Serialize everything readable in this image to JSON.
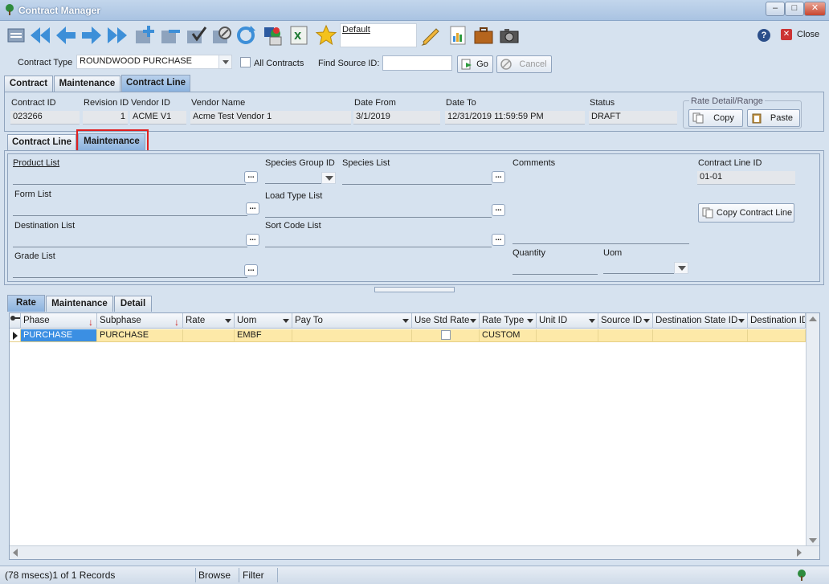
{
  "window": {
    "title": "Contract Manager"
  },
  "toolbar": {
    "default_label": "Default",
    "close_label": "Close"
  },
  "filter": {
    "contract_type_label": "Contract Type",
    "contract_type_value": "ROUNDWOOD PURCHASE",
    "all_contracts_label": "All Contracts",
    "find_source_label": "Find Source ID:",
    "find_source_value": "",
    "go_label": "Go",
    "cancel_label": "Cancel"
  },
  "main_tabs": [
    "Contract",
    "Maintenance",
    "Contract Line"
  ],
  "header": {
    "contract_id_label": "Contract ID",
    "contract_id": "023266",
    "revision_id_label": "Revision ID",
    "revision_id": "1",
    "vendor_id_label": "Vendor ID",
    "vendor_id": "ACME V1",
    "vendor_name_label": "Vendor Name",
    "vendor_name": "Acme Test Vendor 1",
    "date_from_label": "Date From",
    "date_from": "3/1/2019",
    "date_to_label": "Date To",
    "date_to": "12/31/2019 11:59:59 PM",
    "status_label": "Status",
    "status": "DRAFT",
    "rate_group_label": "Rate Detail/Range",
    "copy_label": "Copy",
    "paste_label": "Paste"
  },
  "sub_tabs": [
    "Contract Line",
    "Maintenance"
  ],
  "line": {
    "product_list_label": "Product List",
    "form_list_label": "Form List",
    "destination_list_label": "Destination List",
    "grade_list_label": "Grade List",
    "species_group_label": "Species Group ID",
    "species_list_label": "Species List",
    "load_type_label": "Load Type List",
    "sort_code_label": "Sort Code List",
    "comments_label": "Comments",
    "quantity_label": "Quantity",
    "uom_label": "Uom",
    "contract_line_id_label": "Contract Line ID",
    "contract_line_id": "01-01",
    "copy_line_label": "Copy Contract Line",
    "ellipsis": "..."
  },
  "rate_tabs": [
    "Rate",
    "Maintenance",
    "Detail"
  ],
  "grid": {
    "columns": [
      "Phase",
      "Subphase",
      "Rate",
      "Uom",
      "Pay To",
      "Use Std Rate",
      "Rate Type",
      "Unit ID",
      "Source ID",
      "Destination State ID",
      "Destination ID"
    ],
    "rows": [
      [
        "PURCHASE",
        "PURCHASE",
        "",
        "EMBF",
        "",
        "",
        "CUSTOM",
        "",
        "",
        "",
        ""
      ]
    ]
  },
  "status": {
    "records": "(78 msecs)1 of 1 Records",
    "mode": "Browse",
    "filter": "Filter"
  }
}
